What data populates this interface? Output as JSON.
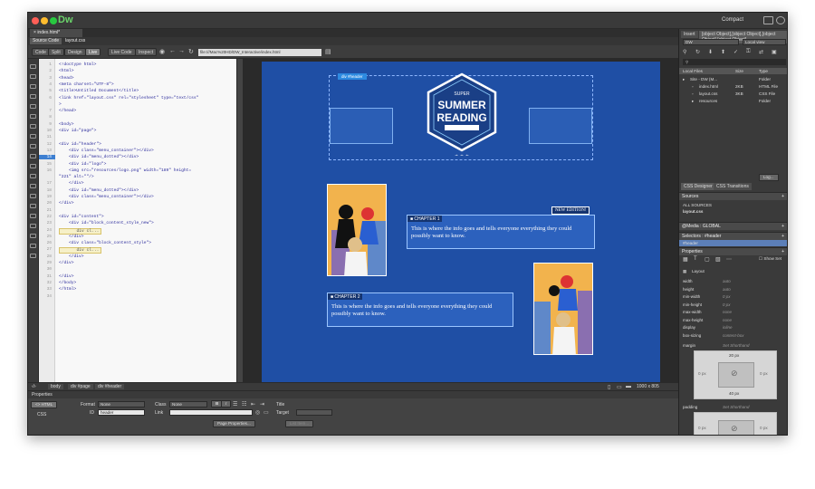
{
  "app": {
    "name": "Dw",
    "workspace": "Compact"
  },
  "document": {
    "tab": "index.html*",
    "source": "Source Code",
    "related": "layout.css"
  },
  "toolbar": {
    "code": "Code",
    "split": "Split",
    "design": "Design",
    "live": "Live",
    "live_code": "Live Code",
    "inspect": "Inspect",
    "url": "file:///Mac%20HD/DW_Interactive/index.html"
  },
  "code_lines": [
    {
      "n": "1",
      "text": "<!doctype html>"
    },
    {
      "n": "2",
      "text": "<html>"
    },
    {
      "n": "3",
      "text": "<head>"
    },
    {
      "n": "4",
      "text": "<meta charset=\"UTF-8\">"
    },
    {
      "n": "5",
      "text": "<title>Untitled Document</title>"
    },
    {
      "n": "6",
      "text": "<link href=\"layout.css\" rel=\"stylesheet\" type=\"text/css\""
    },
    {
      "n": "",
      "text": ">"
    },
    {
      "n": "7",
      "text": "</head>"
    },
    {
      "n": "8",
      "text": ""
    },
    {
      "n": "9",
      "text": "<body>"
    },
    {
      "n": "10",
      "text": "<div id=\"page\">"
    },
    {
      "n": "11",
      "text": ""
    },
    {
      "n": "12",
      "text": "<div id=\"header\">"
    },
    {
      "n": "13",
      "text": "    <div class=\"menu_container\"></div>"
    },
    {
      "n": "14",
      "text": "    <div id=\"menu_dotted\"></div>"
    },
    {
      "n": "15",
      "text": "    <div id=\"logo\">"
    },
    {
      "n": "16",
      "text": "    <img src=\"resources/logo.png\" width=\"189\" height="
    },
    {
      "n": "",
      "text": "\"221\" alt=\"\"/>"
    },
    {
      "n": "17",
      "text": "    </div>"
    },
    {
      "n": "18",
      "text": "    <div id=\"menu_dotted\"></div>"
    },
    {
      "n": "19",
      "text": "    <div class=\"menu_container\"></div>"
    },
    {
      "n": "20",
      "text": "</div>"
    },
    {
      "n": "21",
      "text": ""
    },
    {
      "n": "22",
      "text": "<div id=\"content\">"
    },
    {
      "n": "23",
      "text": "    <div id=\"block_content_style_new\">"
    },
    {
      "n": "24",
      "text": "      div cl..."
    },
    {
      "n": "25",
      "text": "    </div>"
    },
    {
      "n": "26",
      "text": "    <div class=\"block_content_style\">"
    },
    {
      "n": "27",
      "text": "      div cl..."
    },
    {
      "n": "28",
      "text": "    </div>"
    },
    {
      "n": "29",
      "text": "</div>"
    },
    {
      "n": "30",
      "text": ""
    },
    {
      "n": "31",
      "text": "</div>"
    },
    {
      "n": "32",
      "text": "</body>"
    },
    {
      "n": "33",
      "text": "</html>"
    },
    {
      "n": "34",
      "text": ""
    }
  ],
  "current_line": "14",
  "design": {
    "header_tag": "div #header",
    "logo": {
      "super": "SUPER",
      "line1": "SUMMER",
      "line2": "READING",
      "stars": "★ ★ ★"
    },
    "new_edition": "NEW EDITION!",
    "chapter1": {
      "title": "■ CHAPTER 1",
      "text": "This is where the info goes and tells everyone everything they could possibly want to know."
    },
    "chapter2": {
      "title": "■ CHAPTER 2",
      "text": "This is where the info goes and tells everyone everything they could possibly want to know."
    }
  },
  "statusbar": {
    "crumbs": [
      "body",
      "div #page",
      "div #header"
    ],
    "size": "1000 x 805"
  },
  "properties": {
    "title": "Properties",
    "html": "<> HTML",
    "css": "CSS",
    "format_label": "Format",
    "format_value": "None",
    "class_label": "Class",
    "class_value": "None",
    "id_label": "ID",
    "id_value": "header",
    "link_label": "Link",
    "title_label": "Title",
    "target_label": "Target",
    "page_props": "Page Properties...",
    "list_item": "List Item..."
  },
  "right_panel": {
    "insert": "Insert",
    "files": [
      {
        "name": "Site - DW (M...",
        "size": "",
        "type": "Folder"
      },
      {
        "name": "index.html",
        "size": "2KB",
        "type": "HTML File"
      },
      {
        "name": "layout.css",
        "size": "3KB",
        "type": "CSS File"
      },
      {
        "name": "resources",
        "size": "",
        "type": "Folder"
      }
    ],
    "site": "DW",
    "view": "Local view",
    "cols": {
      "name": "Local Files",
      "size": "Size",
      "type": "Type"
    },
    "log": "Log...",
    "css_designer": "CSS Designer",
    "css_transitions": "CSS Transitions",
    "sources": "Sources",
    "all_sources": "ALL SOURCES",
    "layout_css": "layout.css",
    "media": "@Media : GLOBAL",
    "selectors": "Selectors : #header",
    "selector_item": "#header",
    "properties": "Properties",
    "show_set": "Show Set",
    "layout": "Layout",
    "props": [
      {
        "k": "width",
        "v": "auto"
      },
      {
        "k": "height",
        "v": "auto"
      },
      {
        "k": "min-width",
        "v": "0 px"
      },
      {
        "k": "min-height",
        "v": "0 px"
      },
      {
        "k": "max-width",
        "v": "none"
      },
      {
        "k": "max-height",
        "v": "none"
      },
      {
        "k": "display",
        "v": "inline"
      },
      {
        "k": "box-sizing",
        "v": "content-box"
      }
    ],
    "margin": "margin",
    "margin_hint": "Set Shorthand",
    "margin_top": "20 px",
    "margin_bottom": "40 px",
    "margin_side": "0 px",
    "padding": "padding",
    "padding_hint": "Set Shorthand",
    "padding_side": "0 px"
  }
}
